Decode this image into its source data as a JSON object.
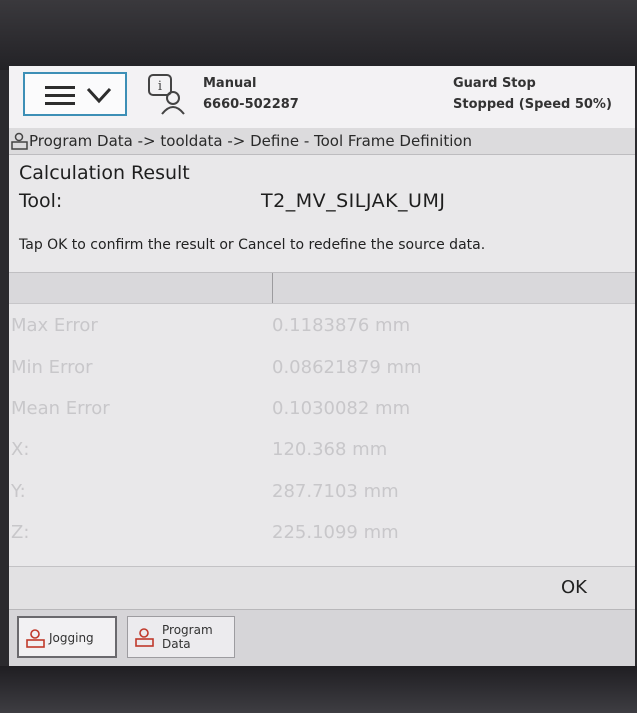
{
  "header": {
    "mode": "Manual",
    "controller_id": "6660-502287",
    "status_line1": "Guard Stop",
    "status_line2": "Stopped (Speed 50%)"
  },
  "breadcrumb": "Program Data -> tooldata -> Define - Tool Frame Definition",
  "content": {
    "title": "Calculation Result",
    "tool_label": "Tool:",
    "tool_value": "T2_MV_SILJAK_UMJ",
    "instruction": "Tap OK to confirm the result or Cancel to redefine the source data."
  },
  "results": [
    {
      "label": "Max Error",
      "value": "0.1183876 mm"
    },
    {
      "label": "Min Error",
      "value": "0.08621879 mm"
    },
    {
      "label": "Mean Error",
      "value": "0.1030082 mm"
    },
    {
      "label": "X:",
      "value": "120.368 mm"
    },
    {
      "label": "Y:",
      "value": "287.7103 mm"
    },
    {
      "label": "Z:",
      "value": "225.1099 mm"
    }
  ],
  "buttons": {
    "ok": "OK"
  },
  "taskbar": {
    "jogging": "Jogging",
    "program_data": "Program Data"
  },
  "colors": {
    "accent": "#3d8fb6",
    "faded_text": "#c8c7ca"
  }
}
